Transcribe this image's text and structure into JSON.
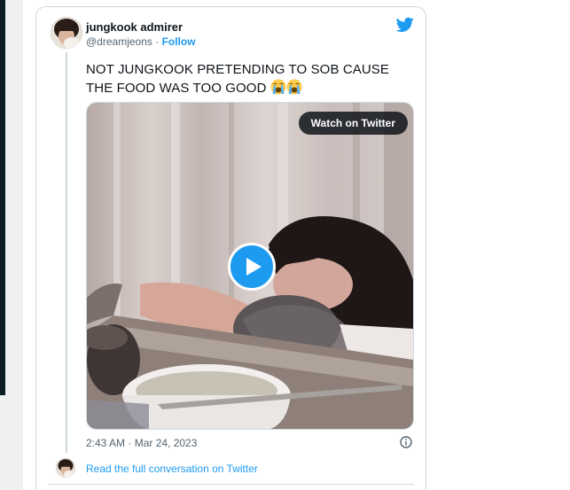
{
  "tweet": {
    "display_name": "jungkook admirer",
    "handle": "@dreamjeons",
    "separator": " · ",
    "follow_label": "Follow",
    "text": "NOT JUNGKOOK PRETENDING TO SOB CAUSE THE FOOD WAS TOO GOOD",
    "emoji": [
      "loudly-crying-face",
      "loudly-crying-face"
    ],
    "media": {
      "watch_label": "Watch on Twitter",
      "play_icon": "play-icon"
    },
    "timestamp": "2:43 AM · Mar 24, 2023",
    "info_icon": "info-icon",
    "conversation_link": "Read the full conversation on Twitter"
  },
  "colors": {
    "accent": "#1d9bf0",
    "text": "#0f1419",
    "muted": "#536471",
    "border": "#cfd9de"
  }
}
